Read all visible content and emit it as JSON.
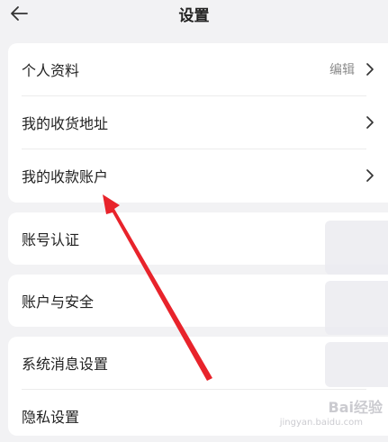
{
  "header": {
    "title": "设置",
    "back_icon": "arrow-left-icon"
  },
  "groups": [
    {
      "items": [
        {
          "label": "个人资料",
          "value": "编辑",
          "icon": "chevron-right-icon"
        },
        {
          "label": "我的收货地址",
          "icon": "chevron-right-icon"
        },
        {
          "label": "我的收款账户",
          "icon": "chevron-right-icon"
        }
      ]
    },
    {
      "items": [
        {
          "label": "账号认证"
        }
      ]
    },
    {
      "items": [
        {
          "label": "账户与安全"
        }
      ]
    },
    {
      "items": [
        {
          "label": "系统消息设置"
        },
        {
          "label": "隐私设置"
        }
      ]
    }
  ],
  "annotation": {
    "color": "#e8232b",
    "shape": "arrow"
  },
  "watermark": {
    "text": "Bai经验",
    "subtext": "jingyan.baidu.com"
  },
  "colors": {
    "background": "#f2f2f4",
    "card": "#ffffff",
    "secondary_text": "#8c8c8c"
  }
}
